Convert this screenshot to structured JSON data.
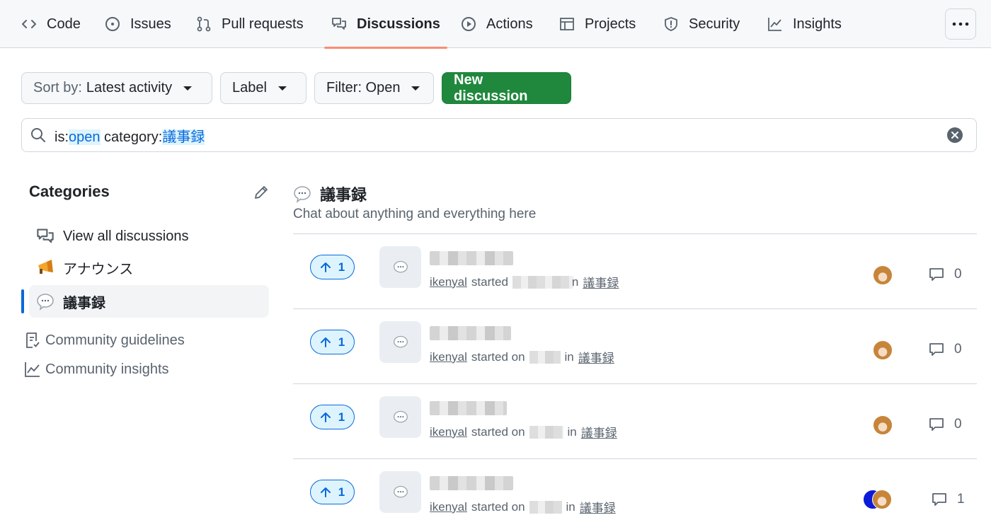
{
  "nav": {
    "tabs": [
      {
        "label": "Code",
        "icon": "code-icon"
      },
      {
        "label": "Issues",
        "icon": "issue-icon"
      },
      {
        "label": "Pull requests",
        "icon": "pull-request-icon"
      },
      {
        "label": "Discussions",
        "icon": "discussion-icon",
        "active": true
      },
      {
        "label": "Actions",
        "icon": "play-icon"
      },
      {
        "label": "Projects",
        "icon": "table-icon"
      },
      {
        "label": "Security",
        "icon": "shield-icon"
      },
      {
        "label": "Insights",
        "icon": "graph-icon"
      }
    ],
    "more_icon": "kebab-horizontal-icon"
  },
  "toolbar": {
    "sort_prefix": "Sort by:",
    "sort_value": "Latest activity",
    "label_button": "Label",
    "filter_button": "Filter: Open",
    "new_discussion": "New discussion"
  },
  "search": {
    "prefix1": "is:",
    "value1": "open",
    "prefix2": " category:",
    "value2": "議事録"
  },
  "sidebar": {
    "title": "Categories",
    "items": [
      {
        "label": "View all discussions",
        "icon": "discussion-icon"
      },
      {
        "label": "アナウンス",
        "icon": "megaphone-icon"
      },
      {
        "label": "議事録",
        "icon": "speech-balloon-icon",
        "active": true
      }
    ],
    "links": [
      {
        "label": "Community guidelines",
        "icon": "checklist-icon"
      },
      {
        "label": "Community insights",
        "icon": "graph-icon"
      }
    ]
  },
  "category": {
    "name": "議事録",
    "description": "Chat about anything and everything here"
  },
  "discussions": [
    {
      "votes": "1",
      "author": "ikenyal",
      "started": "started",
      "on": "",
      "in": "n",
      "category": "議事録",
      "comments": "0"
    },
    {
      "votes": "1",
      "author": "ikenyal",
      "started": "started on",
      "in": "in",
      "category": "議事録",
      "comments": "0"
    },
    {
      "votes": "1",
      "author": "ikenyal",
      "started": "started on",
      "in": "in",
      "category": "議事録",
      "comments": "0"
    },
    {
      "votes": "1",
      "author": "ikenyal",
      "started": "started on",
      "in": "in",
      "category": "議事録",
      "comments": "1"
    }
  ],
  "colors": {
    "accent": "#0969da",
    "primary_button": "#1f883d",
    "active_tab_underline": "#fd8c73"
  }
}
